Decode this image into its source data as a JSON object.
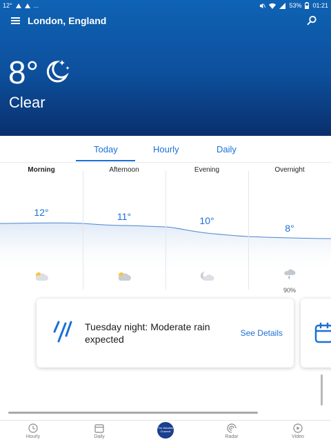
{
  "status_bar": {
    "left_text": "12°",
    "left_trailing": "...",
    "battery": "53%",
    "time": "01:21"
  },
  "header": {
    "location": "London, England"
  },
  "current": {
    "temperature": "8°",
    "condition": "Clear",
    "icon": "moon-stars-icon"
  },
  "tabs": [
    {
      "label": "Today",
      "active": true
    },
    {
      "label": "Hourly",
      "active": false
    },
    {
      "label": "Daily",
      "active": false
    }
  ],
  "periods": [
    {
      "label": "Morning",
      "temp": "12°",
      "temp_value": 12,
      "icon": "partly-sunny-icon",
      "precip": ""
    },
    {
      "label": "Afternoon",
      "temp": "11°",
      "temp_value": 11,
      "icon": "partly-sunny-icon",
      "precip": ""
    },
    {
      "label": "Evening",
      "temp": "10°",
      "temp_value": 10,
      "icon": "partly-cloudy-night-icon",
      "precip": ""
    },
    {
      "label": "Overnight",
      "temp": "8°",
      "temp_value": 8,
      "icon": "thunder-rain-icon",
      "precip": "90%"
    }
  ],
  "alert_card": {
    "text": "Tuesday night: Moderate rain expected",
    "link": "See Details",
    "icon": "rain-icon"
  },
  "next_card": {
    "icon": "calendar-icon"
  },
  "bottom_nav": [
    {
      "label": "Hourly",
      "icon": "clock-icon"
    },
    {
      "label": "Daily",
      "icon": "calendar-icon"
    },
    {
      "label": "The Weather Channel",
      "icon": "twc-logo-icon"
    },
    {
      "label": "Radar",
      "icon": "radar-icon"
    },
    {
      "label": "Video",
      "icon": "play-icon"
    }
  ],
  "colors": {
    "accent": "#1a6fd6",
    "hero_top": "#0f63b5",
    "hero_bottom": "#0a2f6d"
  }
}
